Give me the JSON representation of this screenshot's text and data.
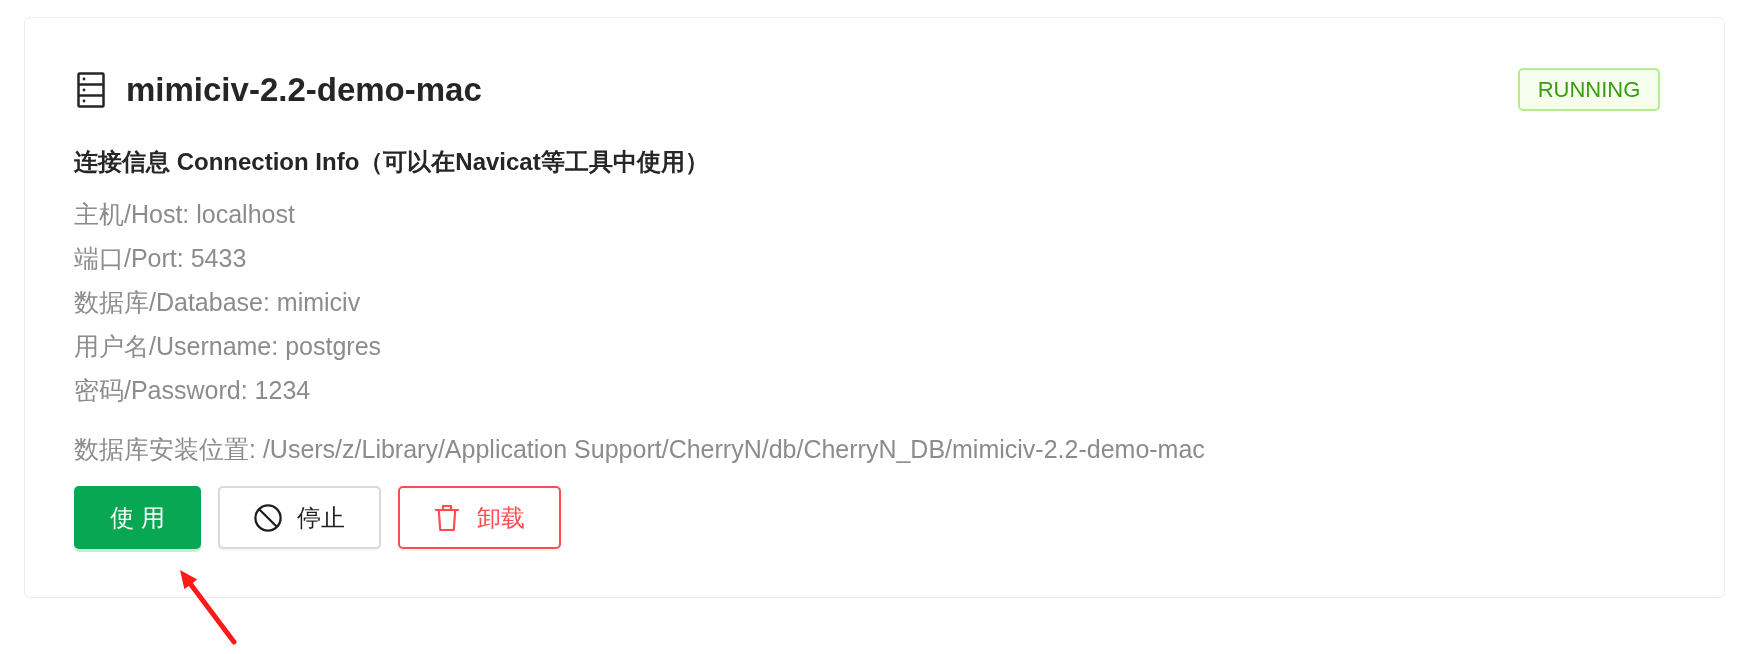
{
  "card": {
    "title": "mimiciv-2.2-demo-mac",
    "status": {
      "label": "RUNNING",
      "kind": "running"
    }
  },
  "connection_info": {
    "heading": "连接信息 Connection Info（可以在Navicat等工具中使用）",
    "fields": [
      "主机/Host: localhost",
      "端口/Port: 5433",
      "数据库/Database: mimiciv",
      "用户名/Username: postgres",
      "密码/Password: 1234"
    ]
  },
  "install_path": "数据库安装位置: /Users/z/Library/Application Support/CherryN/db/CherryN_DB/mimiciv-2.2-demo-mac",
  "buttons": [
    {
      "label": "使 用",
      "kind": "primary"
    },
    {
      "label": "停止",
      "kind": "stop"
    },
    {
      "label": "卸载",
      "kind": "danger"
    }
  ]
}
